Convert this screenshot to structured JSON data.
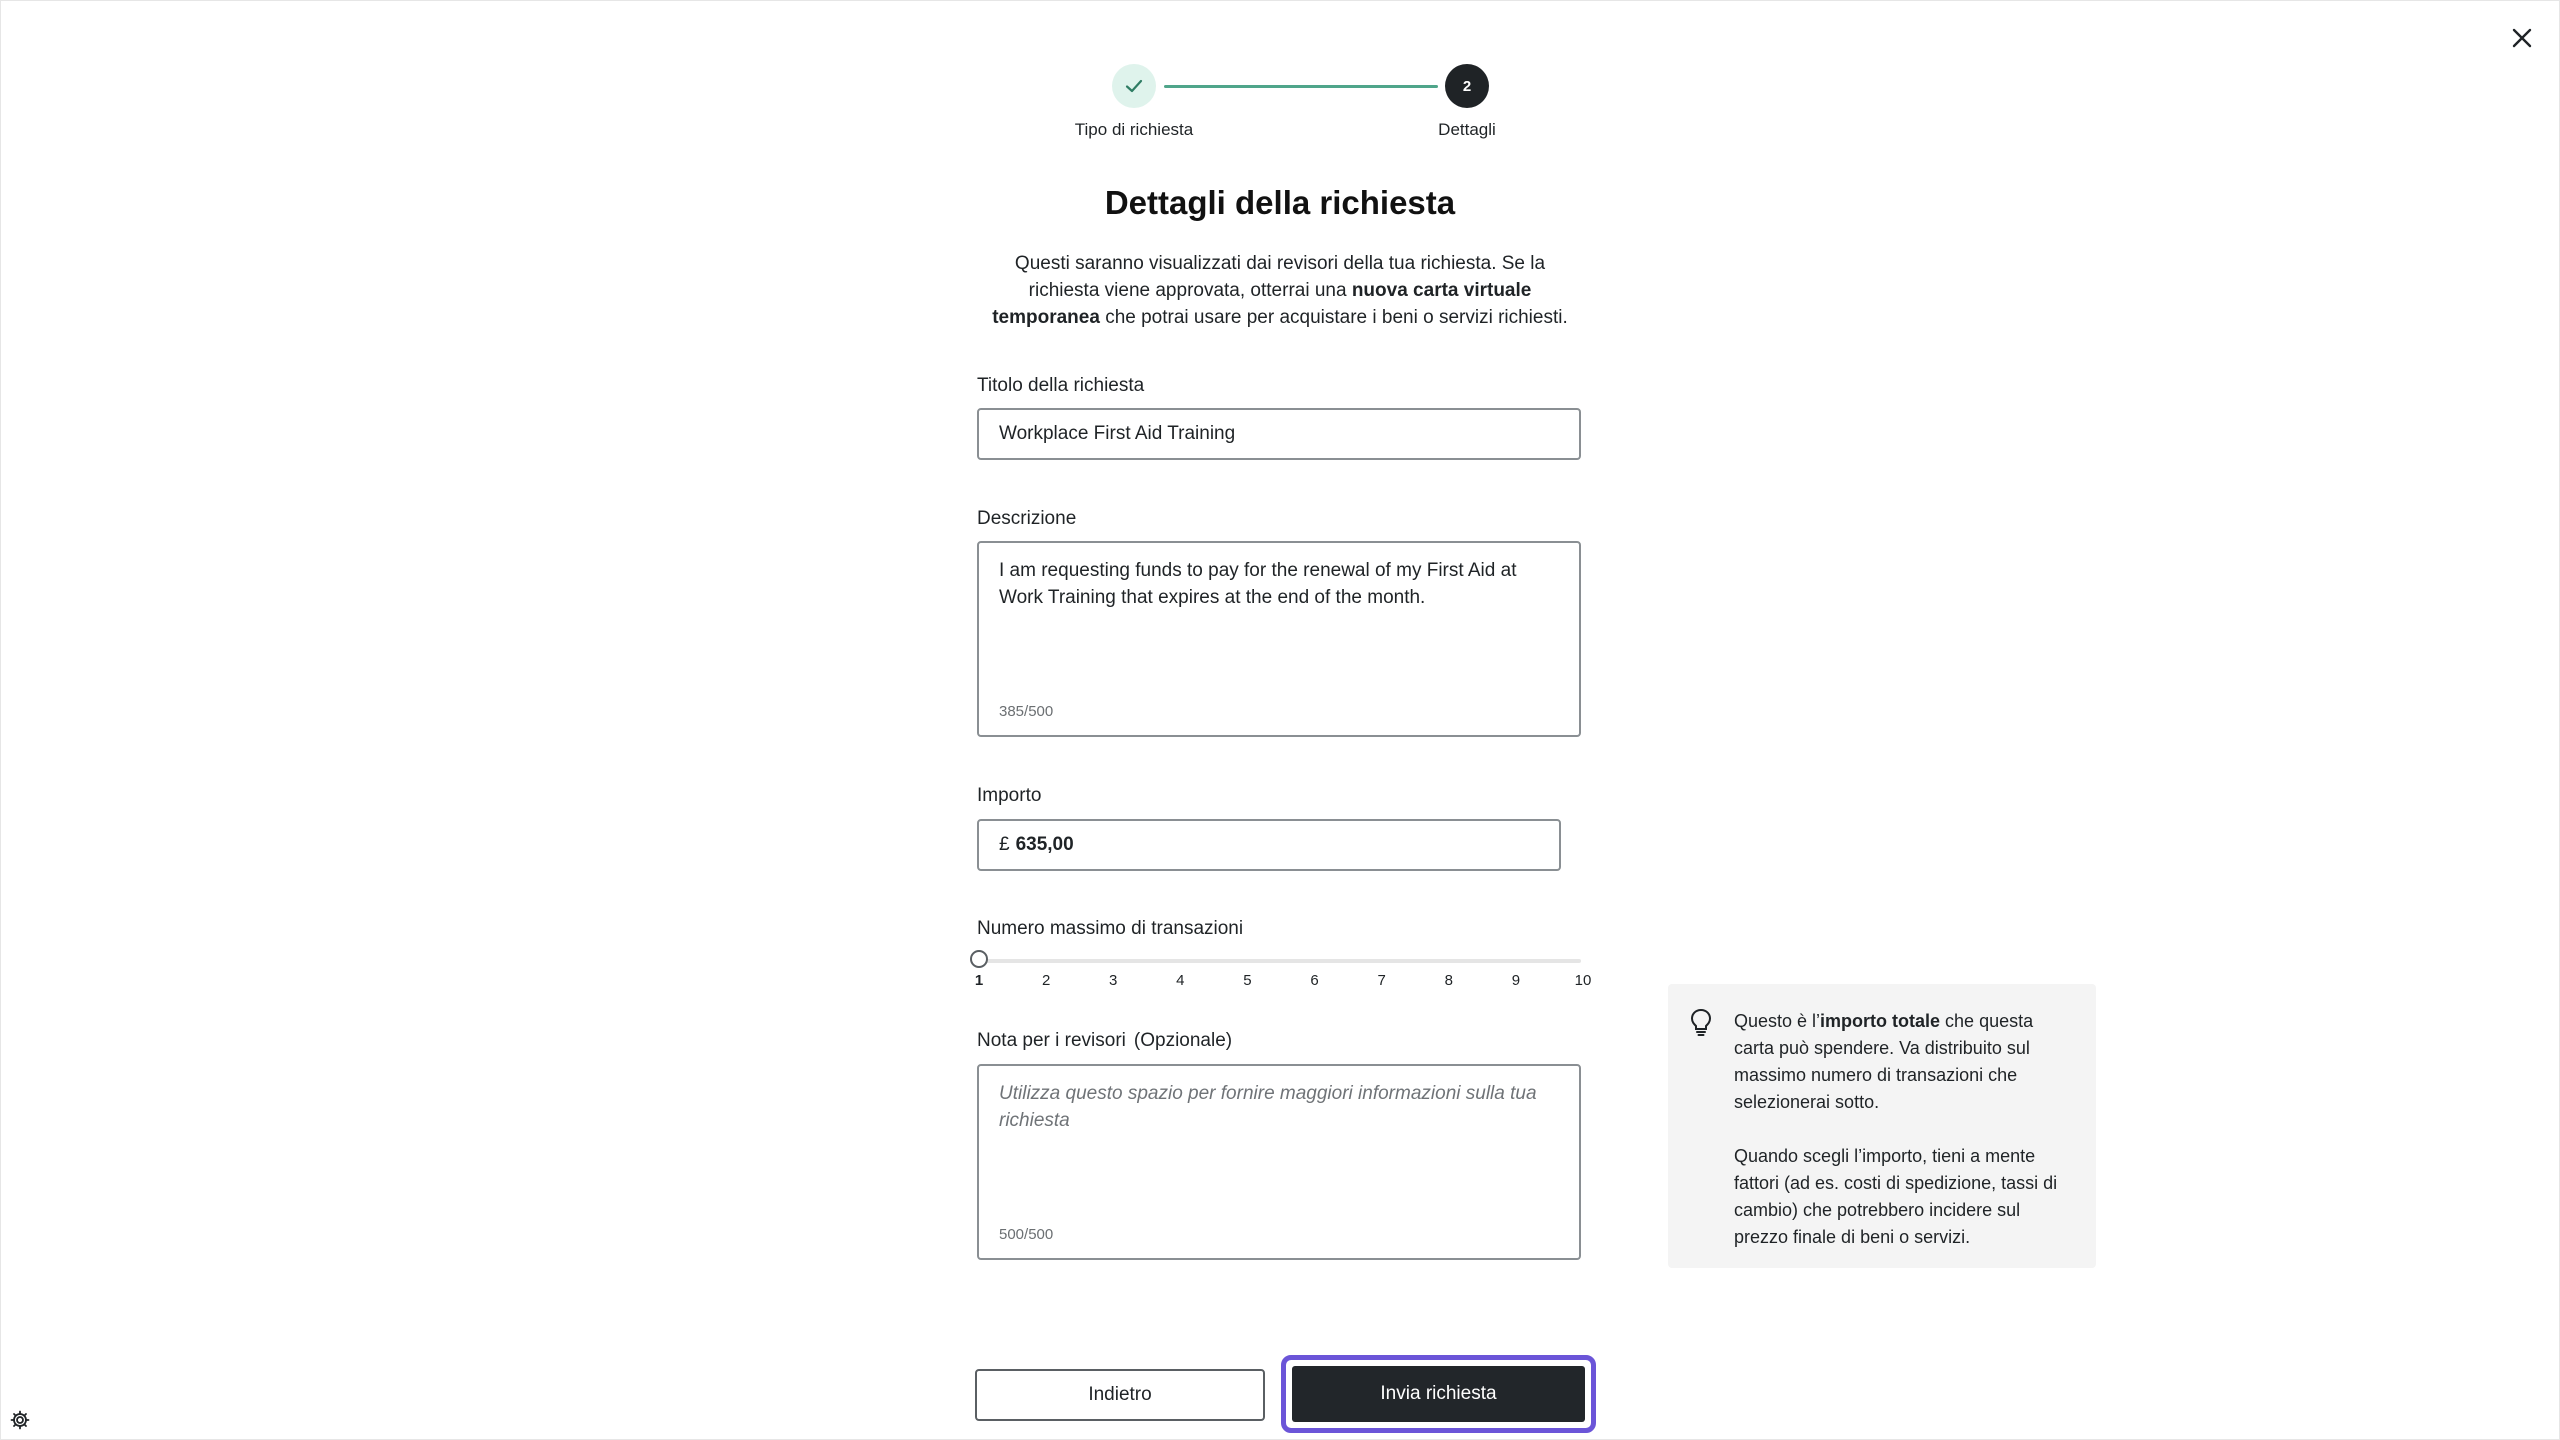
{
  "stepper": {
    "step1_label": "Tipo di richiesta",
    "step2_number": "2",
    "step2_label": "Dettagli"
  },
  "title": "Dettagli della richiesta",
  "intro": {
    "part1": "Questi saranno visualizzati dai revisori della tua richiesta. Se la richiesta viene approvata, otterrai una ",
    "bold": "nuova carta virtuale temporanea",
    "part2": " che potrai usare per acquistare i beni o servizi richiesti."
  },
  "fields": {
    "title_label": "Titolo della richiesta",
    "title_value": "Workplace First Aid Training",
    "description_label": "Descrizione",
    "description_value": "I am requesting funds to pay for the renewal of my First Aid at Work Training that expires at the end of the month.",
    "description_counter": "385/500",
    "amount_label": "Importo",
    "amount_currency": "£",
    "amount_value": "635,00",
    "max_transactions_label": "Numero massimo di transazioni",
    "max_transactions_ticks": [
      "1",
      "2",
      "3",
      "4",
      "5",
      "6",
      "7",
      "8",
      "9",
      "10"
    ],
    "max_transactions_selected": 1,
    "note_label": "Nota per i revisori",
    "note_optional": "(Opzionale)",
    "note_placeholder": "Utilizza questo spazio per fornire maggiori informazioni sulla tua richiesta",
    "note_counter": "500/500"
  },
  "info": {
    "p1_a": "Questo è l’",
    "p1_bold": "importo totale",
    "p1_b": " che questa carta può spendere. Va distribuito sul massimo numero di transazioni che selezionerai sotto.",
    "p2": "Quando scegli l’importo, tieni a mente fattori (ad es. costi di spedizione, tassi di cambio) che potrebbero incidere sul prezzo finale di beni o servizi."
  },
  "buttons": {
    "back": "Indietro",
    "submit": "Invia richiesta"
  },
  "colors": {
    "accent_focus": "#6b55d8",
    "step_done": "#4fa58a",
    "primary_button": "#22262a"
  }
}
